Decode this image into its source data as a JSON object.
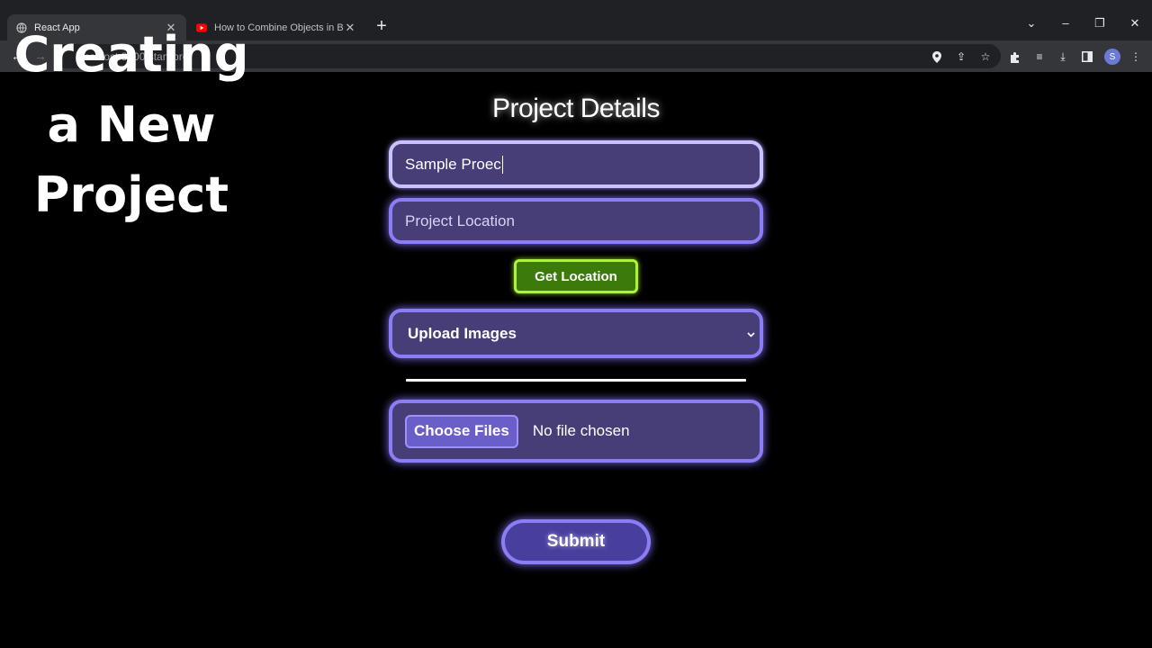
{
  "browser": {
    "tabs": [
      {
        "title": "React App",
        "icon": "globe-icon"
      },
      {
        "title": "How to Combine Objects in Blen",
        "icon": "youtube-icon"
      }
    ],
    "url": "localhost:3000/start-pro",
    "profile_initial": "S"
  },
  "overlay": {
    "line1": "Creating",
    "line2": "a New",
    "line3": "Project"
  },
  "form": {
    "title": "Project Details",
    "name_value": "Sample Proec",
    "location_placeholder": "Project Location",
    "get_location_label": "Get Location",
    "upload_select_value": "Upload Images",
    "choose_files_label": "Choose Files",
    "no_file_text": "No file chosen",
    "submit_label": "Submit"
  },
  "colors": {
    "field_bg": "#473e78",
    "field_border": "#8a7df5",
    "location_button_bg": "#3d7a0c",
    "location_button_border": "#aef23a"
  }
}
